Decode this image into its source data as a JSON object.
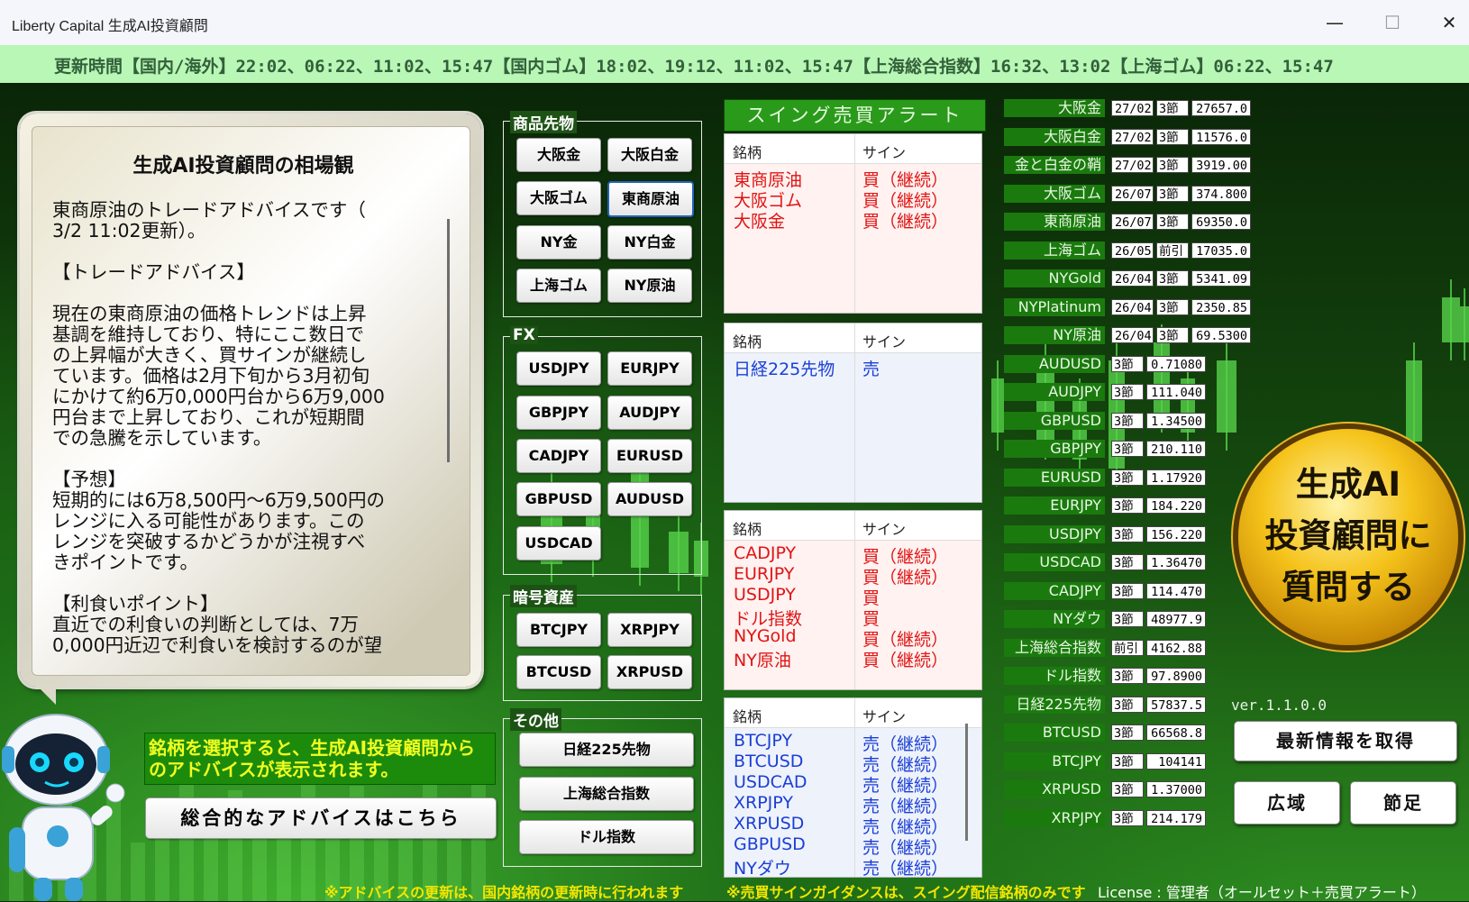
{
  "window": {
    "title": "Liberty Capital 生成AI投資顧問",
    "minimize": "—",
    "maximize": "☐",
    "close": "✕"
  },
  "ticker": "更新時間【国内/海外】22:02、06:22、11:02、15:47【国内ゴム】18:02、19:12、11:02、15:47【上海総合指数】16:32、13:02【上海ゴム】06:22、15:47",
  "advisor": {
    "title": "生成AI投資顧問の相場観",
    "text": "東商原油のトレードアドバイスです（\n3/2 11:02更新）。\n\n【トレードアドバイス】\n\n現在の東商原油の価格トレンドは上昇\n基調を維持しており、特にここ数日で\nの上昇幅が大きく、買サインが継続し\nています。価格は2月下旬から3月初旬\nにかけて約6万0,000円台から6万9,000\n円台まで上昇しており、これが短期間\nでの急騰を示しています。\n\n【予想】\n短期的には6万8,500円～6万9,500円の\nレンジに入る可能性があります。この\nレンジを突破するかどうかが注視すべ\nきポイントです。\n\n【利食いポイント】\n直近での利食いの判断としては、7万\n0,000円近辺で利食いを検討するのが望"
  },
  "notice": "銘柄を選択すると、生成AI投資顧問からのアドバイスが表示されます。",
  "overall_button": "総合的なアドバイスはこちら",
  "groups": {
    "commodity": {
      "label": "商品先物",
      "buttons": [
        "大阪金",
        "大阪白金",
        "大阪ゴム",
        "東商原油",
        "NY金",
        "NY白金",
        "上海ゴム",
        "NY原油"
      ]
    },
    "fx": {
      "label": "FX",
      "buttons": [
        "USDJPY",
        "EURJPY",
        "GBPJPY",
        "AUDJPY",
        "CADJPY",
        "EURUSD",
        "GBPUSD",
        "AUDUSD",
        "USDCAD"
      ]
    },
    "crypto": {
      "label": "暗号資産",
      "buttons": [
        "BTCJPY",
        "XRPJPY",
        "BTCUSD",
        "XRPUSD"
      ]
    },
    "other": {
      "label": "その他",
      "buttons": [
        "日経225先物",
        "上海総合指数",
        "ドル指数"
      ]
    }
  },
  "alerts": {
    "title": "スイング売買アラート",
    "col_name": "銘柄",
    "col_sign": "サイン",
    "panels": [
      {
        "rows": [
          {
            "n": "東商原油",
            "s": "買（継続）",
            "t": "buy"
          },
          {
            "n": "大阪ゴム",
            "s": "買（継続）",
            "t": "buy"
          },
          {
            "n": "大阪金",
            "s": "買（継続）",
            "t": "buy"
          }
        ]
      },
      {
        "rows": [
          {
            "n": "日経225先物",
            "s": "売",
            "t": "sell"
          }
        ]
      },
      {
        "rows": [
          {
            "n": "CADJPY",
            "s": "買（継続）",
            "t": "buy"
          },
          {
            "n": "EURJPY",
            "s": "買（継続）",
            "t": "buy"
          },
          {
            "n": "USDJPY",
            "s": "買",
            "t": "buy"
          },
          {
            "n": "ドル指数",
            "s": "買",
            "t": "buy"
          },
          {
            "n": "NYGold",
            "s": "買（継続）",
            "t": "buy"
          },
          {
            "n": "NY原油",
            "s": "買（継続）",
            "t": "buy"
          }
        ]
      },
      {
        "rows": [
          {
            "n": "BTCJPY",
            "s": "売（継続）",
            "t": "sell"
          },
          {
            "n": "BTCUSD",
            "s": "売（継続）",
            "t": "sell"
          },
          {
            "n": "USDCAD",
            "s": "売（継続）",
            "t": "sell"
          },
          {
            "n": "XRPJPY",
            "s": "売（継続）",
            "t": "sell"
          },
          {
            "n": "XRPUSD",
            "s": "売（継続）",
            "t": "sell"
          },
          {
            "n": "GBPUSD",
            "s": "売（継続）",
            "t": "sell"
          },
          {
            "n": "NYダウ",
            "s": "売（継続）",
            "t": "sell"
          }
        ]
      }
    ]
  },
  "prices": [
    {
      "name": "大阪金",
      "date": "27/02",
      "sess": "3節",
      "val": "27657.0"
    },
    {
      "name": "大阪白金",
      "date": "27/02",
      "sess": "3節",
      "val": "11576.0"
    },
    {
      "name": "金と白金の鞘",
      "date": "27/02",
      "sess": "3節",
      "val": "3919.00"
    },
    {
      "name": "大阪ゴム",
      "date": "26/07",
      "sess": "3節",
      "val": "374.800"
    },
    {
      "name": "東商原油",
      "date": "26/07",
      "sess": "3節",
      "val": "69350.0"
    },
    {
      "name": "上海ゴム",
      "date": "26/05",
      "sess": "前引",
      "val": "17035.0"
    },
    {
      "name": "NYGold",
      "date": "26/04",
      "sess": "3節",
      "val": "5341.09"
    },
    {
      "name": "NYPlatinum",
      "date": "26/04",
      "sess": "3節",
      "val": "2350.85"
    },
    {
      "name": "NY原油",
      "date": "26/04",
      "sess": "3節",
      "val": "69.5300"
    },
    {
      "name": "AUDUSD",
      "date": "",
      "sess": "3節",
      "val": "0.71080"
    },
    {
      "name": "AUDJPY",
      "date": "",
      "sess": "3節",
      "val": "111.040"
    },
    {
      "name": "GBPUSD",
      "date": "",
      "sess": "3節",
      "val": "1.34500"
    },
    {
      "name": "GBPJPY",
      "date": "",
      "sess": "3節",
      "val": "210.110"
    },
    {
      "name": "EURUSD",
      "date": "",
      "sess": "3節",
      "val": "1.17920"
    },
    {
      "name": "EURJPY",
      "date": "",
      "sess": "3節",
      "val": "184.220"
    },
    {
      "name": "USDJPY",
      "date": "",
      "sess": "3節",
      "val": "156.220"
    },
    {
      "name": "USDCAD",
      "date": "",
      "sess": "3節",
      "val": "1.36470"
    },
    {
      "name": "CADJPY",
      "date": "",
      "sess": "3節",
      "val": "114.470"
    },
    {
      "name": "NYダウ",
      "date": "",
      "sess": "3節",
      "val": "48977.9"
    },
    {
      "name": "上海総合指数",
      "date": "",
      "sess": "前引",
      "val": "4162.88"
    },
    {
      "name": "ドル指数",
      "date": "",
      "sess": "3節",
      "val": "97.8900"
    },
    {
      "name": "日経225先物",
      "date": "",
      "sess": "3節",
      "val": "57837.5"
    },
    {
      "name": "BTCUSD",
      "date": "",
      "sess": "3節",
      "val": "66568.8"
    },
    {
      "name": "BTCJPY",
      "date": "",
      "sess": "3節",
      "val": "104141"
    },
    {
      "name": "XRPUSD",
      "date": "",
      "sess": "3節",
      "val": "1.37000"
    },
    {
      "name": "XRPJPY",
      "date": "",
      "sess": "3節",
      "val": "214.179"
    }
  ],
  "big_button": [
    "生成AI",
    "投資顧問に",
    "質問する"
  ],
  "version": "ver.1.1.0.0",
  "buttons": {
    "refresh": "最新情報を取得",
    "wide": "広域",
    "setsuashi": "節足"
  },
  "footer": {
    "note1": "※アドバイスの更新は、国内銘柄の更新時に行われます",
    "note2": "※売買サインガイダンスは、スイング配信銘柄のみです",
    "license": "License : 管理者（オールセット＋売買アラート）"
  },
  "colors": {
    "buy": "#e01414",
    "sell": "#1a3fd6",
    "ticker_bg": "#b9f7b6",
    "price_label_bg": "#1b7a0e",
    "footer_text": "#f3e600"
  }
}
